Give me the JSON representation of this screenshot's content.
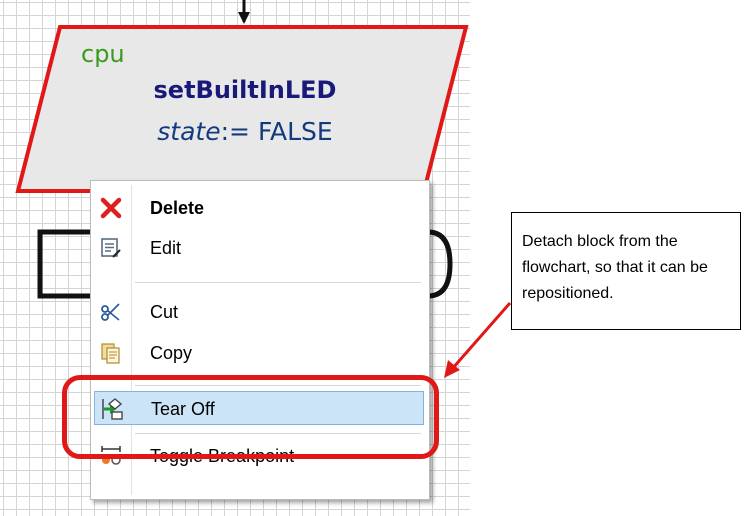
{
  "flowchart": {
    "block": {
      "target": "cpu",
      "action": "setBuiltInLED",
      "variable": "state",
      "operator": ":=",
      "value": "FALSE"
    }
  },
  "context_menu": {
    "items": [
      {
        "label": "Delete",
        "icon": "delete-x-icon",
        "bold": true
      },
      {
        "label": "Edit",
        "icon": "edit-icon"
      },
      {
        "label": "Cut",
        "icon": "scissors-icon"
      },
      {
        "label": "Copy",
        "icon": "copy-icon"
      },
      {
        "label": "Tear Off",
        "icon": "tear-off-icon",
        "highlighted": true
      },
      {
        "label": "Toggle Breakpoint",
        "icon": "breakpoint-icon"
      }
    ]
  },
  "annotation": {
    "callout_text": "Detach block from the flowchart, so that it can be repositioned.",
    "highlight_color": "#e01818"
  },
  "colors": {
    "block_fill": "#e8e8e8",
    "block_border": "#e01818",
    "menu_hover": "#cce4f7"
  }
}
